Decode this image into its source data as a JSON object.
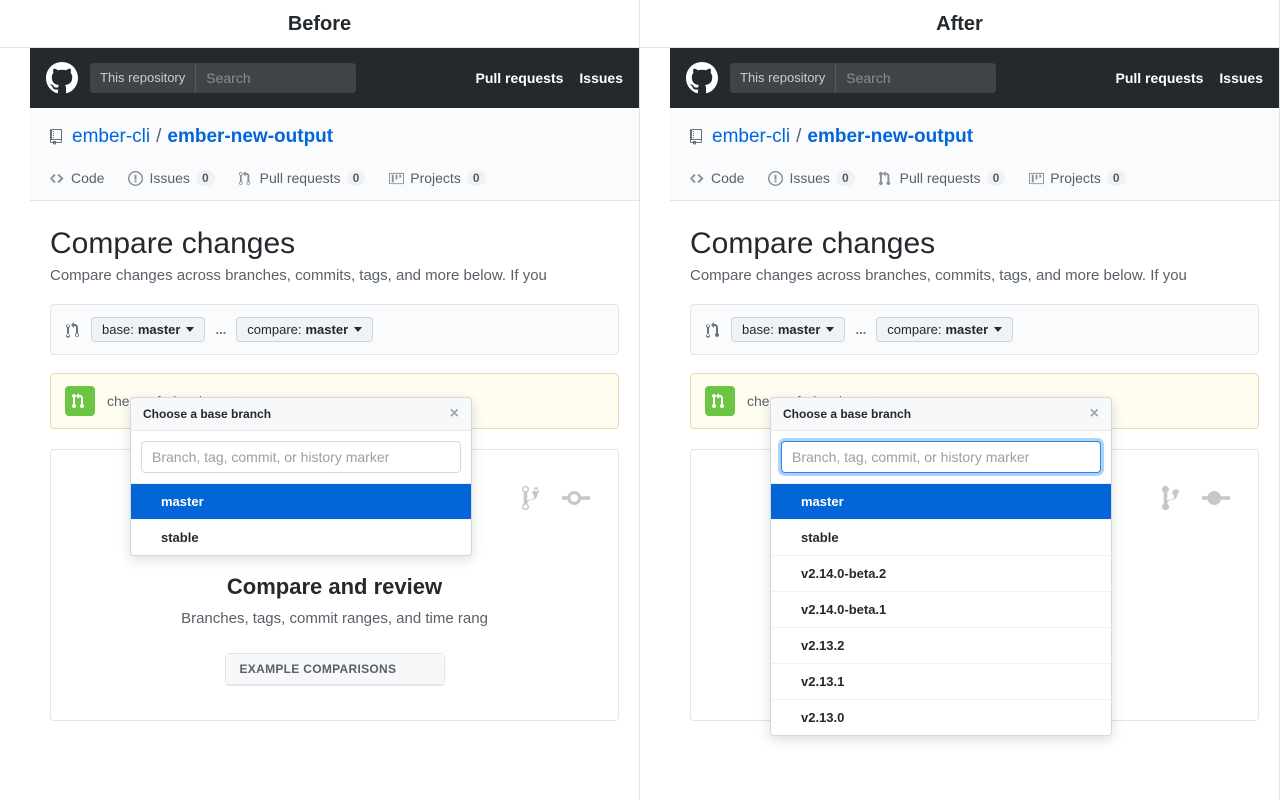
{
  "split": {
    "before": "Before",
    "after": "After"
  },
  "topbar": {
    "scope": "This repository",
    "search_placeholder": "Search",
    "nav": {
      "pulls": "Pull requests",
      "issues": "Issues"
    }
  },
  "repo": {
    "owner": "ember-cli",
    "name": "ember-new-output",
    "sep": "/"
  },
  "tabs": {
    "code": "Code",
    "issues": "Issues",
    "issues_count": "0",
    "pulls": "Pull requests",
    "pulls_count": "0",
    "projects": "Projects",
    "projects_count": "0"
  },
  "compare": {
    "heading": "Compare changes",
    "lead": "Compare changes across branches, commits, tags, and more below. If you",
    "base_prefix": "base:",
    "base_value": "master",
    "compare_prefix": "compare:",
    "compare_value": "master",
    "ellipsis": "..."
  },
  "hint": {
    "text_before": "ches or forks above to"
  },
  "blank": {
    "title": "Compare and review",
    "subtitle_before": "Branches, tags, commit ranges, and time rang",
    "subtitle_after": "anges, and time rang",
    "example_header": "EXAMPLE COMPARISONS"
  },
  "popover": {
    "title": "Choose a base branch",
    "placeholder": "Branch, tag, commit, or history marker",
    "items_before": [
      "master",
      "stable"
    ],
    "items_after": [
      "master",
      "stable",
      "v2.14.0-beta.2",
      "v2.14.0-beta.1",
      "v2.13.2",
      "v2.13.1",
      "v2.13.0"
    ],
    "selected": "master"
  }
}
